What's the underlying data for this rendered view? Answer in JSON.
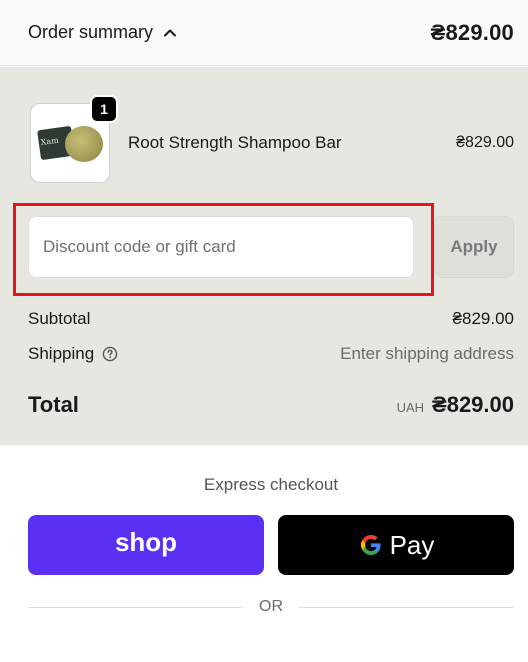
{
  "header": {
    "toggle_label": "Order summary",
    "toggle_icon": "chevron-up-icon",
    "total": "₴829.00"
  },
  "line_items": [
    {
      "name": "Root Strength Shampoo Bar",
      "price": "₴829.00",
      "quantity": "1",
      "thumbnail_text": "Xam"
    }
  ],
  "discount": {
    "placeholder": "Discount code or gift card",
    "value": "",
    "apply_label": "Apply"
  },
  "costs": {
    "subtotal_label": "Subtotal",
    "subtotal_value": "₴829.00",
    "shipping_label": "Shipping",
    "shipping_value": "Enter shipping address"
  },
  "total": {
    "label": "Total",
    "currency_code": "UAH",
    "value": "₴829.00"
  },
  "express": {
    "title": "Express checkout",
    "shop_label": "shop",
    "gpay_label": "Pay"
  },
  "divider_text": "OR",
  "colors": {
    "summary_bg": "#e8e6e1",
    "shop_purple": "#5a31f4",
    "highlight_red": "#e8141c"
  }
}
